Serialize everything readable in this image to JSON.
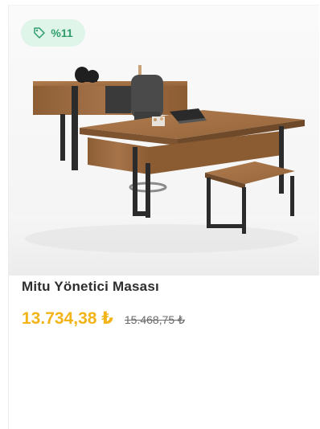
{
  "product": {
    "discount_badge": "%11",
    "name": "Mitu Yönetici Masası",
    "price_current": "13.734,38 ₺",
    "price_old": "15.468,75 ₺",
    "image_alt": "Mitu Yönetici Masası ürün görseli"
  },
  "icons": {
    "badge_icon": "price-tag-icon"
  },
  "colors": {
    "price": "#f2b418",
    "badge_bg": "#dff5ea",
    "badge_text": "#2f9d6a",
    "wood": "#9a6a3d",
    "metal": "#2b2b2b"
  }
}
